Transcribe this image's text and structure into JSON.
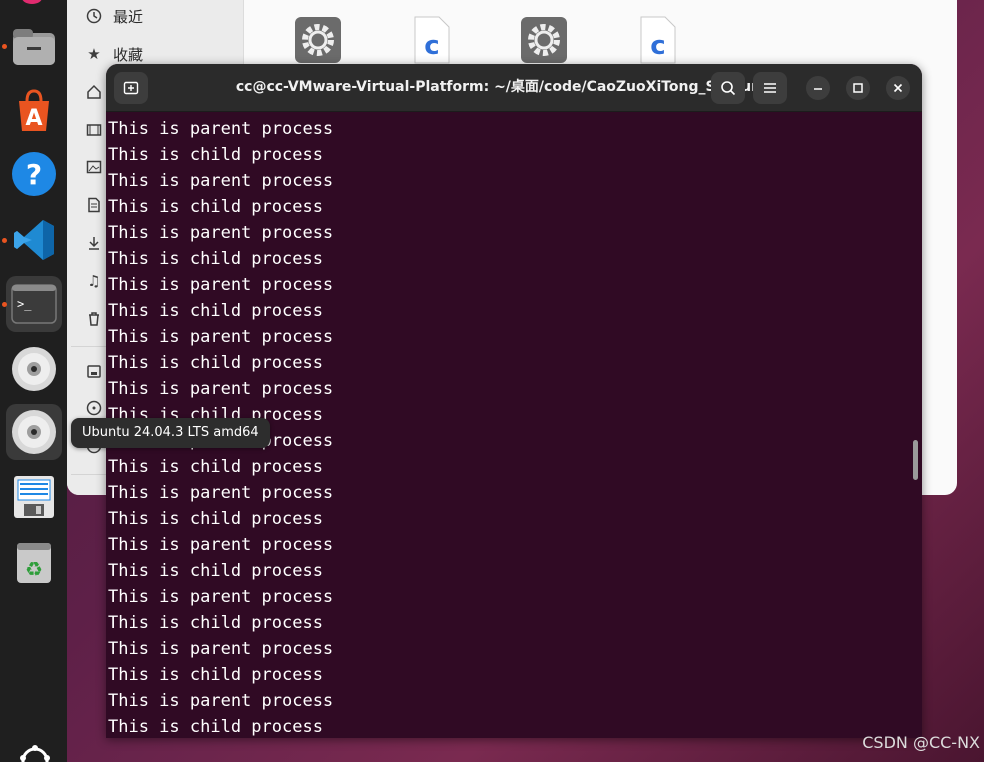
{
  "dock": {
    "items": [
      {
        "name": "files",
        "icon": "files-icon"
      },
      {
        "name": "app-center",
        "icon": "app-center-icon"
      },
      {
        "name": "help",
        "icon": "help-icon"
      },
      {
        "name": "vscode",
        "icon": "vscode-icon"
      },
      {
        "name": "terminal",
        "icon": "terminal-icon"
      },
      {
        "name": "disc-1",
        "icon": "disc-icon"
      },
      {
        "name": "disc-2",
        "icon": "disc-icon"
      },
      {
        "name": "text-editor",
        "icon": "document-icon"
      },
      {
        "name": "trash",
        "icon": "trash-icon"
      }
    ],
    "tooltip": "Ubuntu 24.04.3 LTS amd64"
  },
  "files": {
    "sidebar": [
      {
        "label": "最近",
        "icon": "clock-icon"
      },
      {
        "label": "收藏",
        "icon": "star-icon"
      }
    ],
    "icons": [
      "gear-file-icon",
      "c-file-icon",
      "gear-file-icon",
      "c-file-icon"
    ]
  },
  "terminal": {
    "title": "cc@cc-VMware-Virtual-Platform: ~/桌面/code/CaoZuoXiTong_ShiXun",
    "lines": [
      "This is parent process",
      "This is child process",
      "This is parent process",
      "This is child process",
      "This is parent process",
      "This is child process",
      "This is parent process",
      "This is child process",
      "This is parent process",
      "This is child process",
      "This is parent process",
      "This is child process",
      "This is parent process",
      "This is child process",
      "This is parent process",
      "This is child process",
      "This is parent process",
      "This is child process",
      "This is parent process",
      "This is child process",
      "This is parent process",
      "This is child process",
      "This is parent process",
      "This is child process"
    ],
    "background": "#300a24"
  },
  "watermark": "CSDN @CC-NX",
  "colors": {
    "accent": "#e95420",
    "dock": "#1f1f1f"
  }
}
